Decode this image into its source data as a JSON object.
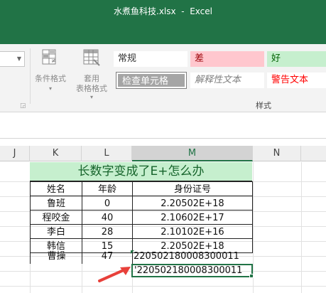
{
  "window": {
    "title": "水煮鱼科技.xlsx  -  Excel"
  },
  "ribbon": {
    "conditional_format": {
      "label": "条件格式",
      "icon": "conditional-format-icon"
    },
    "format_as_table": {
      "label_line1": "套用",
      "label_line2": "表格格式",
      "icon": "table-format-icon"
    },
    "styles": [
      {
        "label": "常规",
        "bg": "#ffffff",
        "color": "#333333"
      },
      {
        "label": "差",
        "bg": "#ffc7ce",
        "color": "#9c0006"
      },
      {
        "label": "好",
        "bg": "#c6efce",
        "color": "#006100"
      },
      {
        "label": "检查单元格",
        "bg": "#a5a5a5",
        "color": "#ffffff"
      },
      {
        "label": "解释性文本",
        "bg": "#ffffff",
        "color": "#7f7f7f"
      },
      {
        "label": "警告文本",
        "bg": "#ffffff",
        "color": "#ff0000"
      }
    ],
    "group_label": "样式"
  },
  "columns": [
    "J",
    "K",
    "L",
    "M",
    "N"
  ],
  "selected_column": "M",
  "table": {
    "title": "长数字变成了E+怎么办",
    "headers": [
      "姓名",
      "年龄",
      "身份证号"
    ],
    "rows": [
      {
        "name": "鲁班",
        "age": "0",
        "id": "2.20502E+18"
      },
      {
        "name": "程咬金",
        "age": "40",
        "id": "2.10602E+17"
      },
      {
        "name": "李白",
        "age": "28",
        "id": "2.10102E+16"
      },
      {
        "name": "韩信",
        "age": "15",
        "id": "2.20502E+18"
      },
      {
        "name": "曹操",
        "age": "47",
        "id": "220502180008300011"
      }
    ],
    "active_cell_value": "'220502180008300011"
  },
  "colors": {
    "accent": "#217346",
    "title_fill": "#c6efce",
    "arrow": "#e8403a"
  }
}
